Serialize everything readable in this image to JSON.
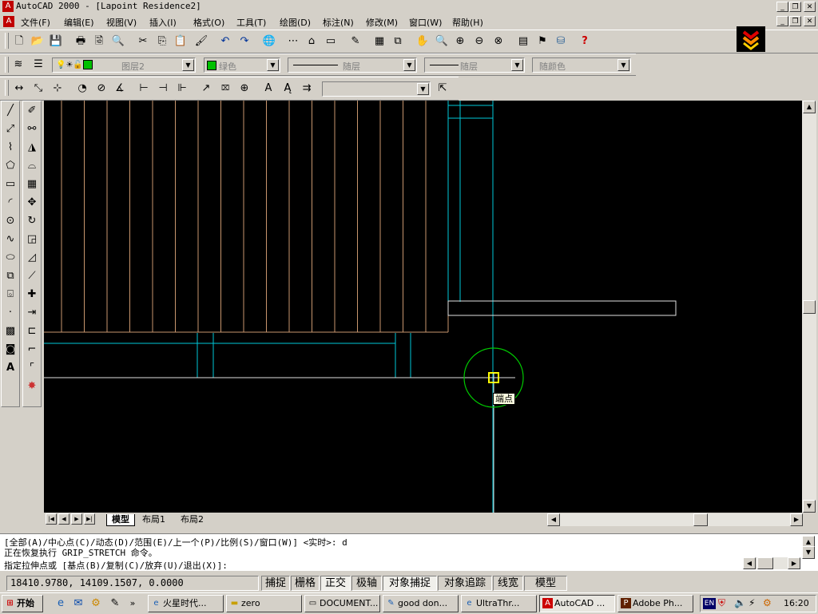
{
  "window": {
    "title": "AutoCAD 2000 - [Lapoint Residence2]"
  },
  "menu": [
    {
      "label": "文件(F)"
    },
    {
      "label": "编辑(E)"
    },
    {
      "label": "视图(V)"
    },
    {
      "label": "插入(I)"
    },
    {
      "label": "格式(O)"
    },
    {
      "label": "工具(T)"
    },
    {
      "label": "绘图(D)"
    },
    {
      "label": "标注(N)"
    },
    {
      "label": "修改(M)"
    },
    {
      "label": "窗口(W)"
    },
    {
      "label": "帮助(H)"
    }
  ],
  "properties": {
    "layer": "图层2",
    "color": "绿色",
    "linetype": "随层",
    "lineweight": "随层",
    "plotstyle": "随颜色",
    "dimstyle": ""
  },
  "canvas": {
    "snap_tooltip": "端点",
    "colors": {
      "background": "#000000",
      "wood": "#c8966e",
      "cyan": "#00c8d8",
      "white": "#e0e0e0",
      "snap_circle": "#00c800",
      "snap_marker": "#ffff00"
    }
  },
  "layout_tabs": [
    {
      "label": "模型"
    },
    {
      "label": "布局1"
    },
    {
      "label": "布局2"
    }
  ],
  "command": {
    "line1": "[全部(A)/中心点(C)/动态(D)/范围(E)/上一个(P)/比例(S)/窗口(W)] <实时>: d",
    "line2": "正在恢复执行 GRIP_STRETCH 命令。",
    "line3": "指定拉伸点或 [基点(B)/复制(C)/放弃(U)/退出(X)]:"
  },
  "status": {
    "coords": "18410.9780, 14109.1507, 0.0000",
    "toggles": [
      "捕捉",
      "栅格",
      "正交",
      "极轴",
      "对象捕捉",
      "对象追踪",
      "线宽",
      "模型"
    ]
  },
  "taskbar": {
    "start": "开始",
    "tasks": [
      {
        "label": "火星时代..."
      },
      {
        "label": "zero"
      },
      {
        "label": "DOCUMENT..."
      },
      {
        "label": "good don..."
      },
      {
        "label": "UltraThr..."
      },
      {
        "label": "AutoCAD ..."
      },
      {
        "label": "Adobe Ph..."
      }
    ],
    "lang": "EN",
    "time": "16:20"
  }
}
